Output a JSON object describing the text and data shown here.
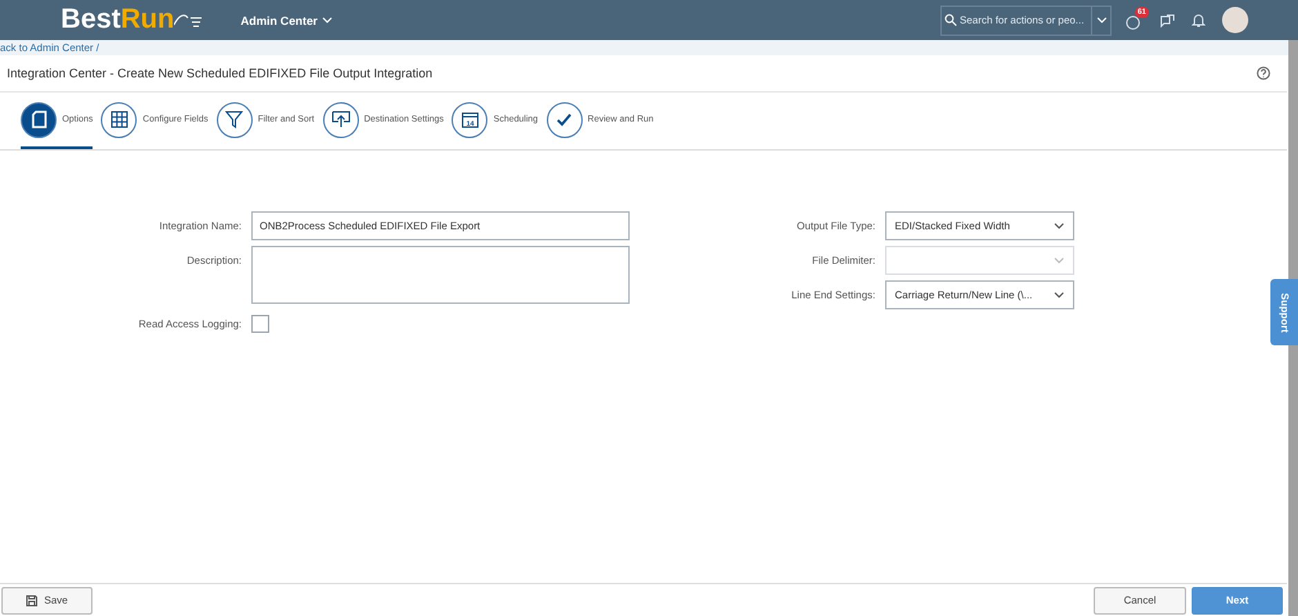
{
  "header": {
    "logo": {
      "part_1": "Best",
      "part_2": "Run"
    },
    "menu": "Admin Center",
    "search": {
      "placeholder": "Search for actions or peo..."
    },
    "notification_count": "61"
  },
  "breadcrumb": "ack to Admin Center /",
  "title": "Integration Center - Create New Scheduled EDIFIXED File Output Integration",
  "steps": [
    {
      "label": "Options",
      "selected": true
    },
    {
      "label": "Configure Fields",
      "selected": false
    },
    {
      "label": "Filter and Sort",
      "selected": false
    },
    {
      "label": "Destination Settings",
      "selected": false
    },
    {
      "label": "Scheduling",
      "selected": false,
      "icon_text": "14"
    },
    {
      "label": "Review and Run",
      "selected": false
    }
  ],
  "left_fields": [
    {
      "kind": "text",
      "label": "Integration Name:",
      "value": "ONB2Process Scheduled EDIFIXED File Export"
    },
    {
      "kind": "textarea",
      "label": "Description:"
    },
    {
      "kind": "checkbox",
      "label": "Read Access Logging:",
      "checked": false
    }
  ],
  "right_fields": [
    {
      "label": "Output File Type:",
      "value": "EDI/Stacked Fixed Width",
      "disabled": false
    },
    {
      "label": "File Delimiter:",
      "disabled": true
    },
    {
      "label": "Line End Settings:",
      "value": "Carriage Return/New Line (\\...",
      "disabled": false
    }
  ],
  "support_tab": "Support",
  "footer": {
    "save": "Save",
    "cancel": "Cancel",
    "next": "Next"
  }
}
